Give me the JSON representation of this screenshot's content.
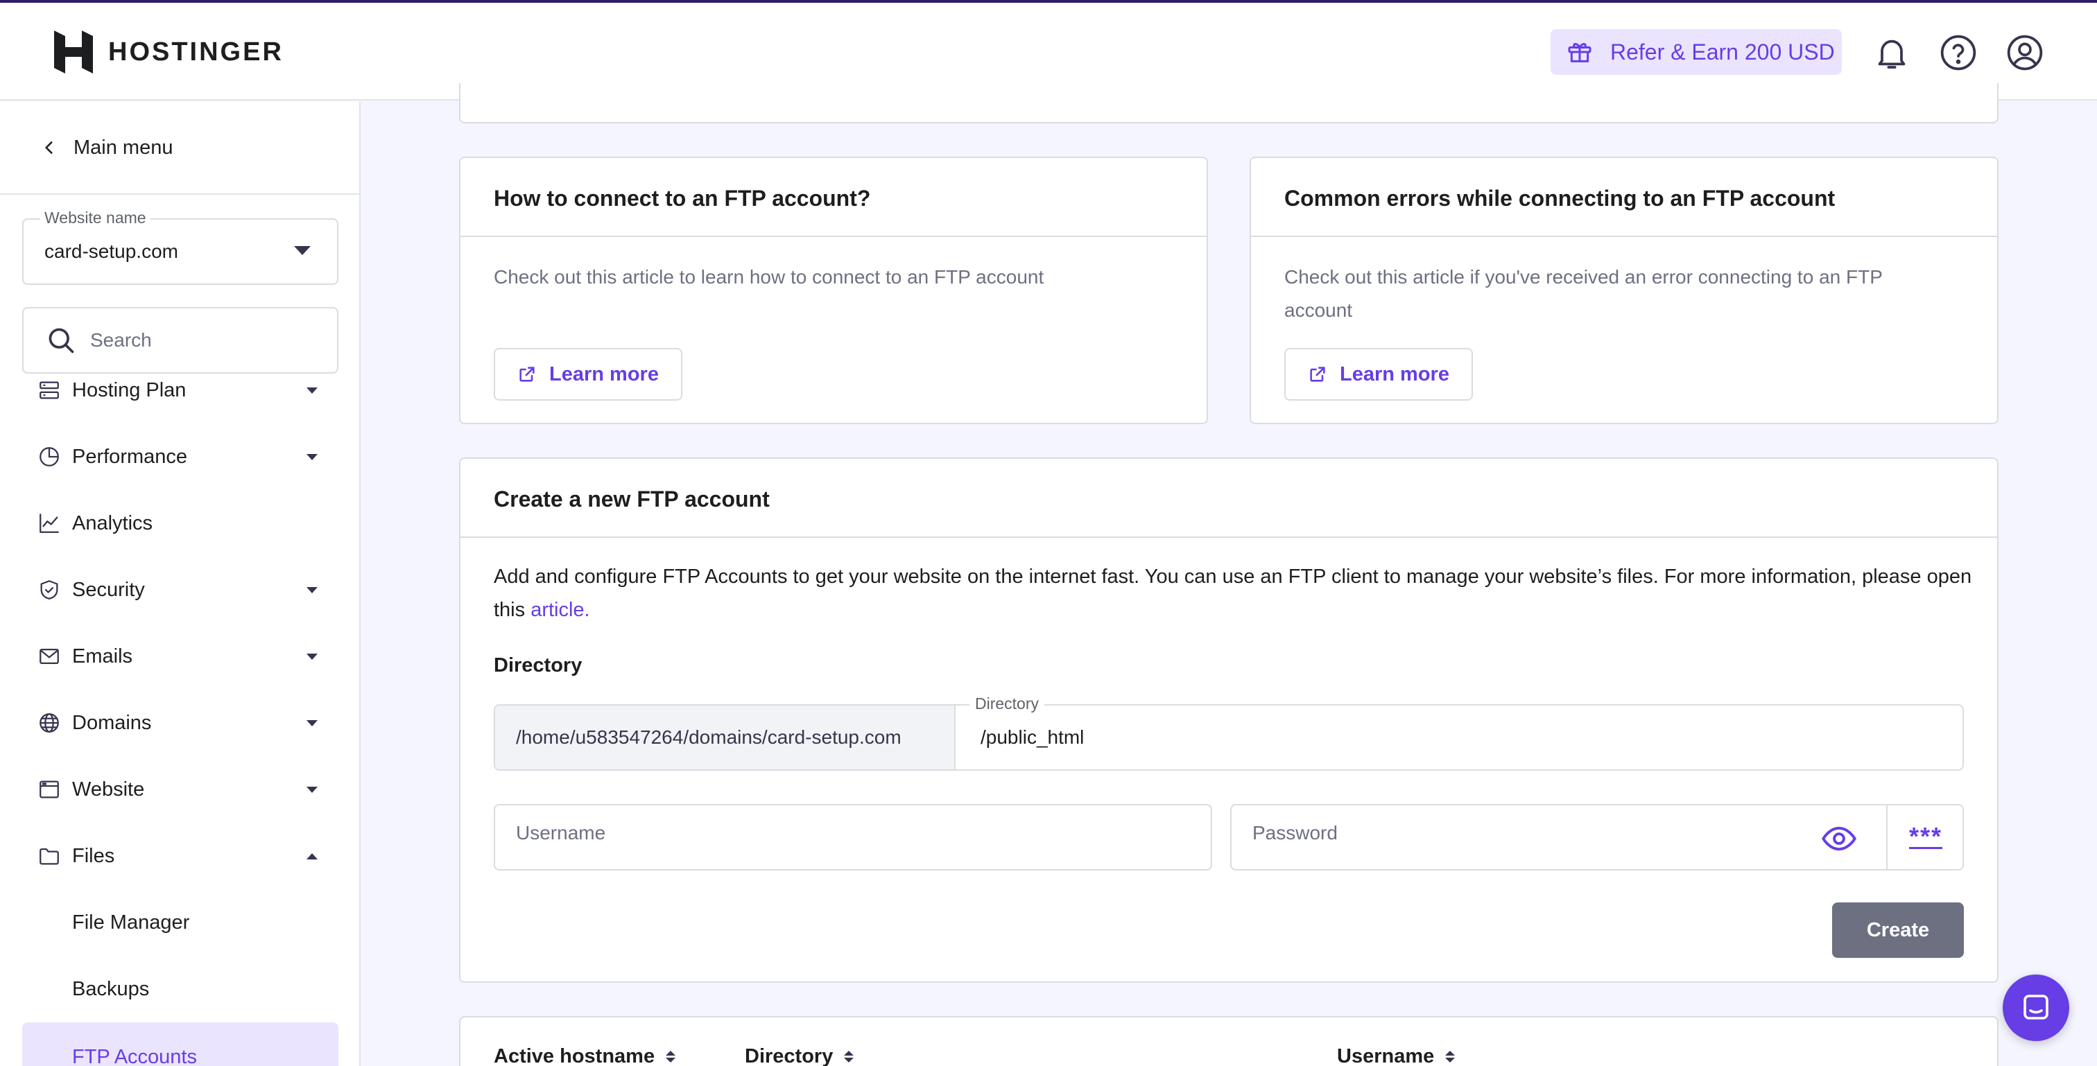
{
  "header": {
    "logo_text": "HOSTINGER",
    "refer_label": "Refer & Earn 200 USD",
    "icons": [
      "bell-icon",
      "help-icon",
      "account-icon"
    ]
  },
  "sidebar": {
    "main_menu_label": "Main menu",
    "website_select": {
      "label": "Website name",
      "value": "card-setup.com"
    },
    "search": {
      "placeholder": "Search"
    },
    "items": [
      {
        "label": "Hosting Plan",
        "icon": "server-icon",
        "expandable": true
      },
      {
        "label": "Performance",
        "icon": "pie-chart-icon",
        "expandable": true
      },
      {
        "label": "Analytics",
        "icon": "line-chart-icon",
        "expandable": false
      },
      {
        "label": "Security",
        "icon": "shield-icon",
        "expandable": true
      },
      {
        "label": "Emails",
        "icon": "mail-icon",
        "expandable": true
      },
      {
        "label": "Domains",
        "icon": "globe-icon",
        "expandable": true
      },
      {
        "label": "Website",
        "icon": "browser-icon",
        "expandable": true
      },
      {
        "label": "Files",
        "icon": "folder-icon",
        "expandable": true,
        "expanded": true
      }
    ],
    "subitems": [
      {
        "label": "File Manager"
      },
      {
        "label": "Backups"
      },
      {
        "label": "FTP Accounts",
        "active": true
      }
    ]
  },
  "help_cards": [
    {
      "title": "How to connect to an FTP account?",
      "text": "Check out this article to learn how to connect to an FTP account",
      "button": "Learn more"
    },
    {
      "title": "Common errors while connecting to an FTP account",
      "text_line1": "Check out this article if you've received an error connecting to an FTP",
      "text_line2": "account",
      "button": "Learn more"
    }
  ],
  "create_card": {
    "title": "Create a new FTP account",
    "description": "Add and configure FTP Accounts to get your website on the internet fast. You can use an FTP client to manage your website’s files. For more information, please open this",
    "link_text": "article.",
    "directory_label": "Directory",
    "directory_prefix": "/home/u583547264/domains/card-setup.com",
    "directory_field_label": "Directory",
    "directory_value": "/public_html",
    "username_placeholder": "Username",
    "password_placeholder": "Password",
    "generate_label": "***",
    "create_button": "Create"
  },
  "table": {
    "columns": [
      "Active hostname",
      "Directory",
      "Username"
    ]
  },
  "colors": {
    "accent": "#673de6",
    "accent_light": "#ebe4ff",
    "background": "#f4f5ff",
    "button_disabled": "#6d7081"
  }
}
